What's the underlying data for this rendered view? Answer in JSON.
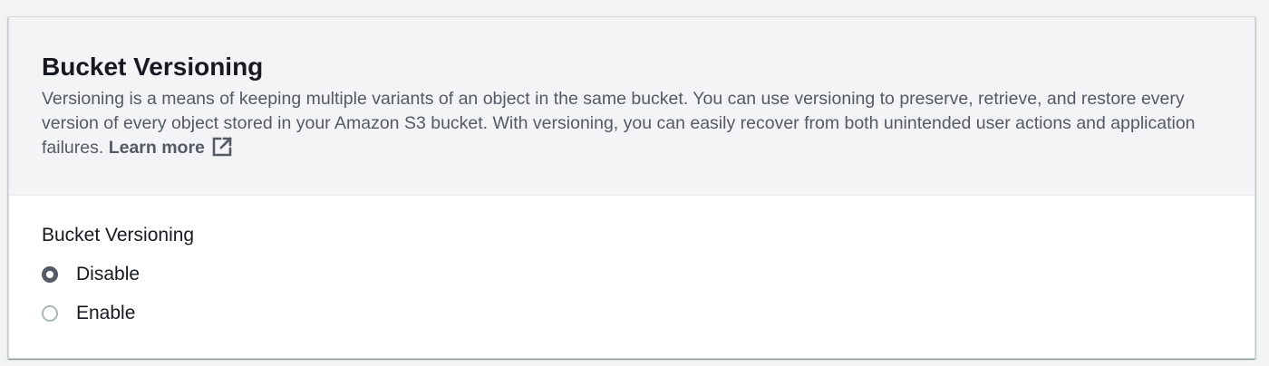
{
  "section": {
    "title": "Bucket Versioning",
    "description": "Versioning is a means of keeping multiple variants of an object in the same bucket. You can use versioning to preserve, retrieve, and restore every version of every object stored in your Amazon S3 bucket. With versioning, you can easily recover from both unintended user actions and application failures.",
    "learn_more_label": "Learn more",
    "learn_more_icon": "external-link-icon"
  },
  "versioning_field": {
    "label": "Bucket Versioning",
    "selected": "Disable",
    "options": [
      {
        "label": "Disable",
        "checked": true
      },
      {
        "label": "Enable",
        "checked": false
      }
    ]
  },
  "colors": {
    "page_background": "#f2f3f3",
    "header_background": "#f3f4f5",
    "heading_text": "#16191f",
    "body_text": "#545b64",
    "radio_selected": "#545b64",
    "radio_unselected_border": "#aab7b8"
  }
}
